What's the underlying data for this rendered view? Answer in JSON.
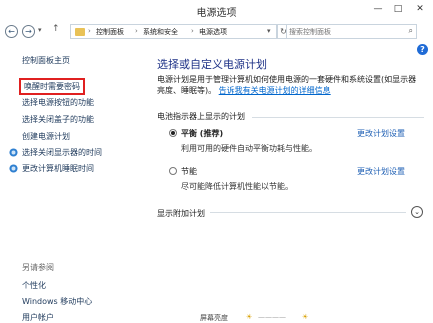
{
  "window": {
    "title": "电源选项",
    "minimize_glyph": "—",
    "maximize_glyph": "□",
    "close_glyph": "✕"
  },
  "address": {
    "back_glyph": "←",
    "forward_glyph": "→",
    "history_glyph": "▾",
    "up_glyph": "↑",
    "crumbs": [
      "控制面板",
      "系统和安全",
      "电源选项"
    ],
    "crumb_separator": "›",
    "dropdown_glyph": "▾",
    "refresh_glyph": "↻",
    "search_placeholder": "搜索控制面板",
    "search_glyph": "⌕"
  },
  "help_glyph": "?",
  "sidebar": {
    "home": "控制面板主页",
    "items": [
      "唤醒时需要密码",
      "选择电源按钮的功能",
      "选择关闭盖子的功能",
      "创建电源计划",
      "选择关闭显示器的时间",
      "更改计算机睡眠时间"
    ],
    "see_also_header": "另请参阅",
    "see_also": [
      "个性化",
      "Windows 移动中心",
      "用户帐户"
    ]
  },
  "main": {
    "title": "选择或自定义电源计划",
    "description": "电源计划是用于管理计算机如何使用电源的一套硬件和系统设置(如显示器亮度、睡眠等)。",
    "description_link": "告诉我有关电源计划的详细信息",
    "section_label": "电池指示器上显示的计划",
    "plans": [
      {
        "name": "平衡 (推荐)",
        "description": "利用可用的硬件自动平衡功耗与性能。",
        "link": "更改计划设置",
        "selected": true
      },
      {
        "name": "节能",
        "description": "尽可能降低计算机性能以节能。",
        "link": "更改计划设置",
        "selected": false
      }
    ],
    "additional_plans": "显示附加计划",
    "expand_glyph": "⌄",
    "bottom_partial": [
      "屏幕亮度",
      "☀",
      "————",
      "☀"
    ]
  },
  "colors": {
    "accent": "#1e3287",
    "link": "#1e5fb4",
    "highlight_border": "#e02020"
  }
}
